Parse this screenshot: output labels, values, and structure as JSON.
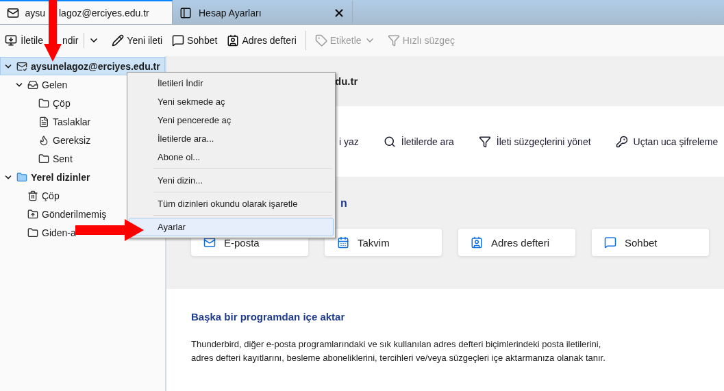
{
  "tabs": [
    {
      "label_parts": [
        "aysu",
        "lagoz@erciyes.edu.tr"
      ],
      "selected": true,
      "closable": false
    },
    {
      "label_parts": [
        "Hesap Ayarları"
      ],
      "selected": false,
      "closable": true
    }
  ],
  "toolbar": [
    {
      "label_parts": [
        "İletile",
        "ndir"
      ],
      "disabled": false,
      "dropdown": true
    },
    {
      "label_parts": [
        "Yeni ileti"
      ],
      "disabled": false,
      "dropdown": false
    },
    {
      "label_parts": [
        "Sohbet"
      ],
      "disabled": false,
      "dropdown": false
    },
    {
      "label_parts": [
        "Adres defteri"
      ],
      "disabled": false,
      "dropdown": false
    },
    {
      "label_parts": [
        "Etiketle"
      ],
      "disabled": true,
      "dropdown": true
    },
    {
      "label_parts": [
        "Hızlı süzgeç"
      ],
      "disabled": true,
      "dropdown": false
    }
  ],
  "sidebar": {
    "items": [
      {
        "label": "aysunelagoz@erciyes.edu.tr",
        "selected": true,
        "expanded": true,
        "children": [
          {
            "label": "Gelen",
            "selected": false,
            "expanded": true,
            "children": [
              {
                "label": "Çöp",
                "selected": false
              },
              {
                "label": "Taslaklar",
                "selected": false
              },
              {
                "label": "Gereksiz",
                "selected": false
              },
              {
                "label": "Sent",
                "selected": false
              }
            ]
          }
        ]
      },
      {
        "label": "Yerel dizinler",
        "selected": false,
        "expanded": true,
        "children": [
          {
            "label": "Çöp",
            "selected": false
          },
          {
            "label": "Gönderilmemiş",
            "selected": false
          },
          {
            "label": "Giden-a",
            "selected": false
          }
        ]
      }
    ]
  },
  "context_menu": [
    {
      "kind": "item",
      "label": "İletileri İndir",
      "selected": false
    },
    {
      "kind": "item",
      "label": "Yeni sekmede aç",
      "selected": false
    },
    {
      "kind": "item",
      "label": "Yeni pencerede aç",
      "selected": false
    },
    {
      "kind": "item",
      "label": "İletilerde ara...",
      "selected": false
    },
    {
      "kind": "item",
      "label": "Abone ol...",
      "selected": false
    },
    {
      "kind": "separator"
    },
    {
      "kind": "item",
      "label": "Yeni dizin...",
      "selected": false
    },
    {
      "kind": "separator"
    },
    {
      "kind": "item",
      "label": "Tüm dizinleri okundu olarak işaretle",
      "selected": false
    },
    {
      "kind": "separator"
    },
    {
      "kind": "item",
      "label": "Ayarlar",
      "selected": true
    }
  ],
  "main": {
    "header": "du.tr",
    "actions": [
      "i yaz",
      "İletilerde ara",
      "İleti süzgeçlerini yönet",
      "Uçtan uca şifreleme"
    ],
    "setup_heading": "n",
    "cards": [
      "E-posta",
      "Takvim",
      "Adres defteri",
      "Sohbet"
    ],
    "import_heading": "Başka bir programdan içe aktar",
    "import_text": "Thunderbird, diğer e-posta programlarındaki ve sık kullanılan adres defteri biçimlerindeki posta iletilerini, adres defteri kayıtlarını, besleme aboneliklerini, tercihleri ve/veya süzgeçleri içe aktarmanıza olanak tanır."
  }
}
